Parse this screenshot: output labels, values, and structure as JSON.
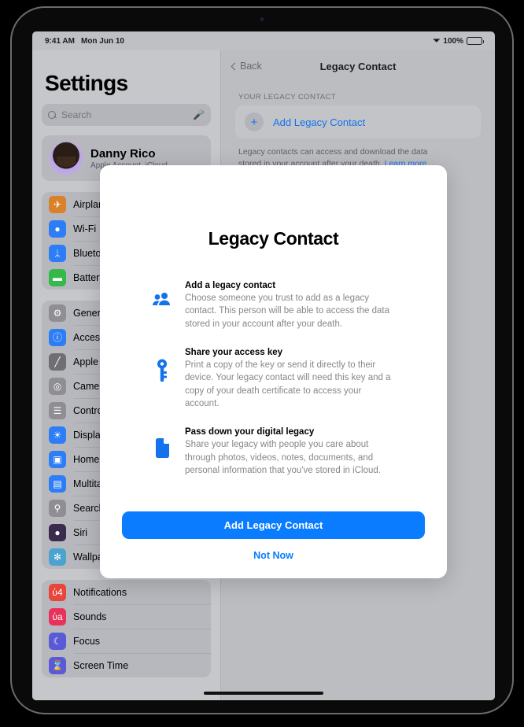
{
  "status_bar": {
    "time": "9:41 AM",
    "date": "Mon Jun 10",
    "wifi_icon": "wifi-icon",
    "battery_percent": "100%",
    "battery_icon": "battery-full-icon"
  },
  "sidebar": {
    "title": "Settings",
    "search": {
      "placeholder": "Search",
      "search_icon": "search-icon",
      "mic_icon": "microphone-icon"
    },
    "profile": {
      "name": "Danny Rico",
      "subtitle": "Apple Account, iCloud",
      "avatar_icon": "avatar-memoji"
    },
    "groups": [
      {
        "items": [
          {
            "label": "Airplane Mode",
            "icon": "airplane-icon",
            "glyph": "✈",
            "color": "#d9822b"
          },
          {
            "label": "Wi-Fi",
            "icon": "wifi-icon",
            "glyph": "●",
            "color": "#2d7df6"
          },
          {
            "label": "Bluetooth",
            "icon": "bluetooth-icon",
            "glyph": "ᛦ",
            "color": "#2d7df6"
          },
          {
            "label": "Battery",
            "icon": "battery-icon",
            "glyph": "▬",
            "color": "#34b94b"
          }
        ]
      },
      {
        "items": [
          {
            "label": "General",
            "icon": "gear-icon",
            "glyph": "⚙",
            "color": "#8e8e93"
          },
          {
            "label": "Accessibility",
            "icon": "accessibility-icon",
            "glyph": "ⓘ",
            "color": "#2d7df6"
          },
          {
            "label": "Apple Pencil",
            "icon": "apple-pencil-icon",
            "glyph": "╱",
            "color": "#6e6e73"
          },
          {
            "label": "Camera",
            "icon": "camera-icon",
            "glyph": "◎",
            "color": "#8e8e93"
          },
          {
            "label": "Control Center",
            "icon": "control-center-icon",
            "glyph": "☰",
            "color": "#8e8e93"
          },
          {
            "label": "Display & Brightness",
            "icon": "brightness-icon",
            "glyph": "☀",
            "color": "#2d7df6"
          },
          {
            "label": "Home Screen & App Library",
            "icon": "home-screen-icon",
            "glyph": "▣",
            "color": "#2d7df6"
          },
          {
            "label": "Multitasking & Gestures",
            "icon": "multitasking-icon",
            "glyph": "▤",
            "color": "#2d7df6"
          },
          {
            "label": "Search",
            "icon": "search-icon",
            "glyph": "⚲",
            "color": "#8e8e93"
          },
          {
            "label": "Siri",
            "icon": "siri-icon",
            "glyph": "●",
            "color": "#3a2b4f"
          },
          {
            "label": "Wallpaper",
            "icon": "wallpaper-icon",
            "glyph": "✻",
            "color": "#4ba3cf"
          }
        ]
      },
      {
        "items": [
          {
            "label": "Notifications",
            "icon": "bell-icon",
            "glyph": "ὑ4",
            "color": "#e8453c"
          },
          {
            "label": "Sounds",
            "icon": "speaker-icon",
            "glyph": "ὐa",
            "color": "#e8315b"
          },
          {
            "label": "Focus",
            "icon": "moon-icon",
            "glyph": "☾",
            "color": "#5a5ad6"
          },
          {
            "label": "Screen Time",
            "icon": "hourglass-icon",
            "glyph": "⌛",
            "color": "#5a5ad6"
          }
        ]
      }
    ]
  },
  "detail": {
    "back_label": "Back",
    "back_icon": "chevron-left-icon",
    "title": "Legacy Contact",
    "section_header": "YOUR LEGACY CONTACT",
    "add_contact_label": "Add Legacy Contact",
    "plus_icon": "plus-icon",
    "footer_text": "Legacy contacts can access and download the data stored in your account after your death. ",
    "learn_more_label": "Learn more..."
  },
  "modal": {
    "title": "Legacy Contact",
    "features": [
      {
        "icon": "two-people-icon",
        "heading": "Add a legacy contact",
        "body": "Choose someone you trust to add as a legacy contact. This person will be able to access the data stored in your account after your death."
      },
      {
        "icon": "key-icon",
        "heading": "Share your access key",
        "body": "Print a copy of the key or send it directly to their device. Your legacy contact will need this key and a copy of your death certificate to access your account."
      },
      {
        "icon": "document-icon",
        "heading": "Pass down your digital legacy",
        "body": "Share your legacy with people you care about through photos, videos, notes, documents, and personal information that you've stored in iCloud."
      }
    ],
    "primary_button": "Add Legacy Contact",
    "secondary_button": "Not Now"
  },
  "colors": {
    "accent_blue": "#0a7cff",
    "link_blue": "#1372ec",
    "screen_bg": "#bfc0c4"
  }
}
